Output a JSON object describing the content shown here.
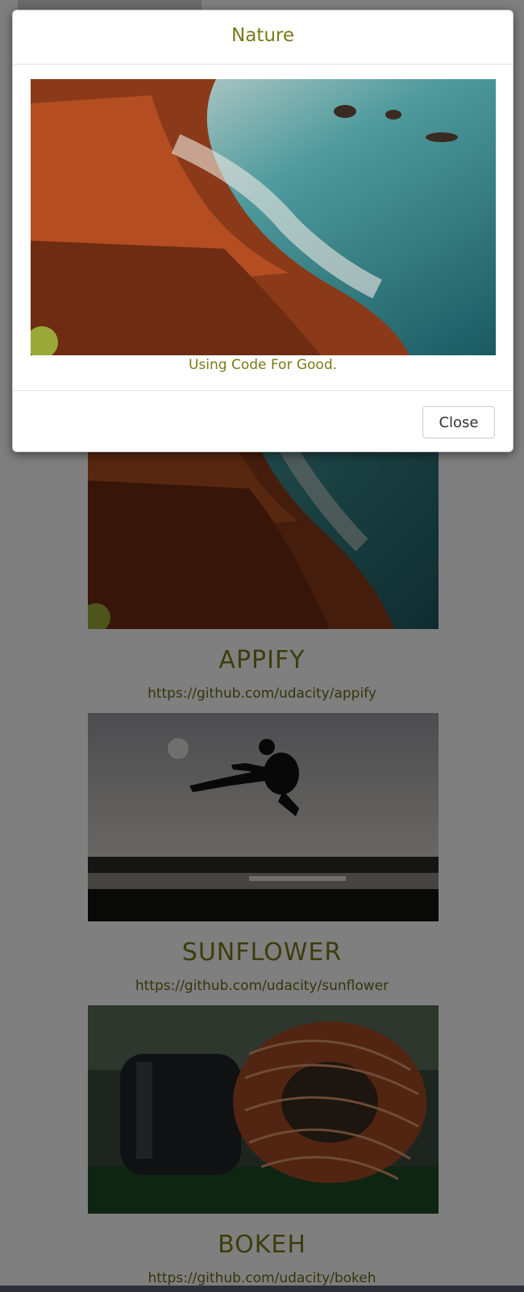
{
  "modal": {
    "title": "Nature",
    "image_icon": "coastline-photo",
    "description": "Using Code For Good.",
    "close_label": "Close"
  },
  "projects": [
    {
      "title": "APPIFY",
      "link": "https://github.com/udacity/appify",
      "image_icon": "coastline-photo"
    },
    {
      "title": "SUNFLOWER",
      "link": "https://github.com/udacity/sunflower",
      "image_icon": "jumping-silhouette-photo"
    },
    {
      "title": "BOKEH",
      "link": "https://github.com/udacity/bokeh",
      "image_icon": "copper-coil-photo"
    }
  ],
  "colors": {
    "accent": "#7a7a19",
    "backdrop": "rgba(0,0,0,0.5)"
  }
}
